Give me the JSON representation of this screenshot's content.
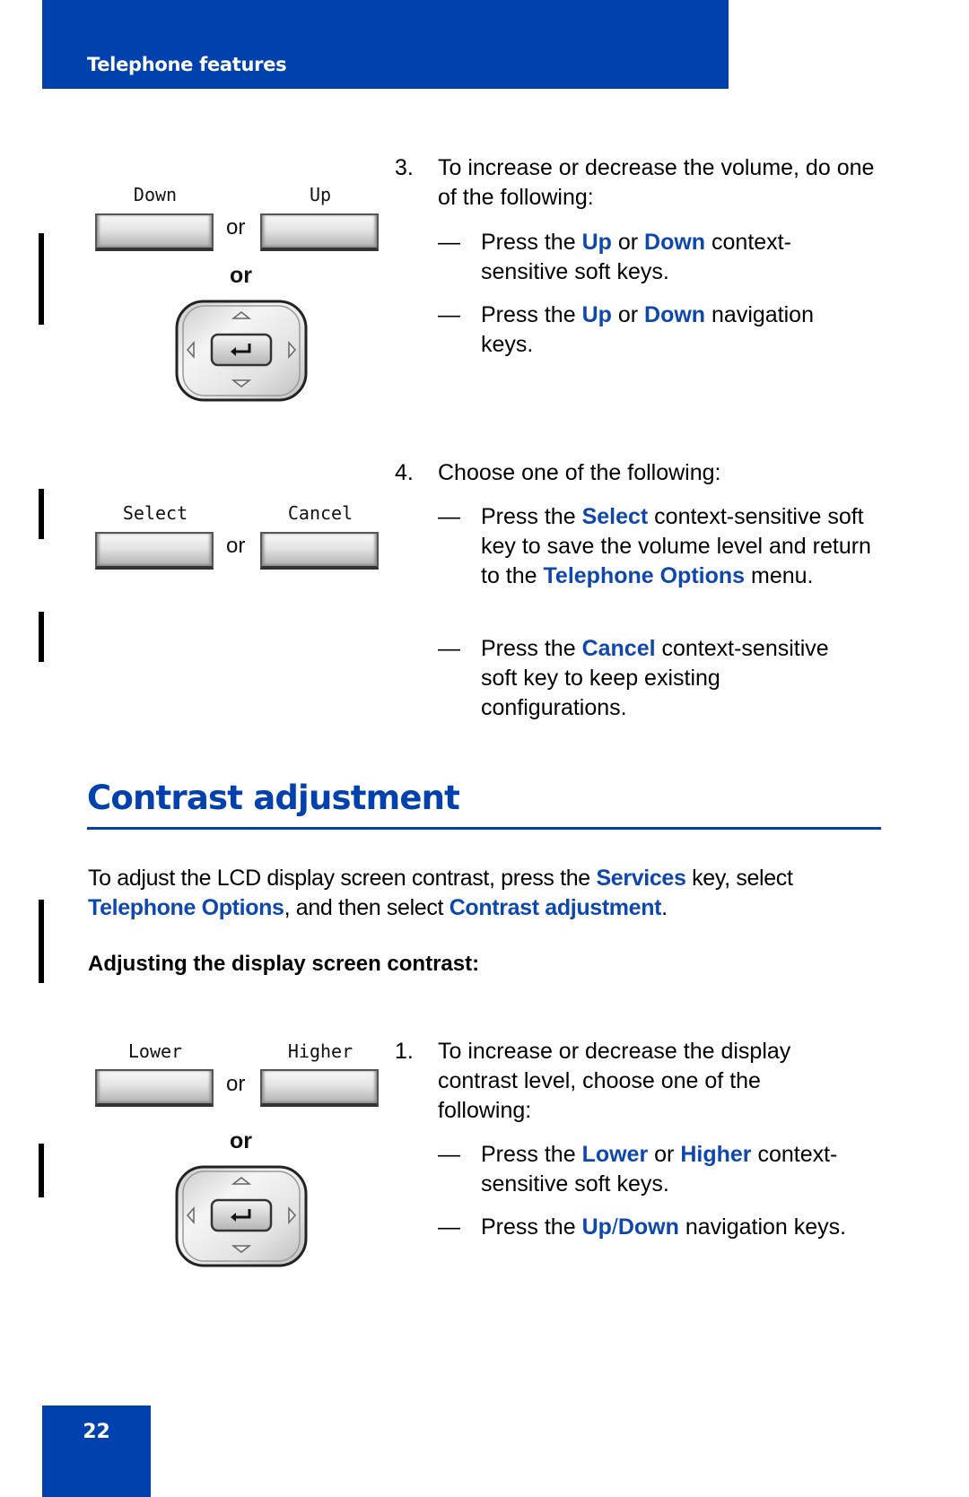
{
  "header": {
    "title": "Telephone features",
    "color": "#0041ad"
  },
  "volume_steps": {
    "softkeys_1": {
      "left_label": "Down",
      "right_label": "Up",
      "or_small": "or",
      "or_bold": "or"
    },
    "step3": {
      "number": "3.",
      "text": "To increase or decrease the volume, do one of the following:",
      "options": [
        {
          "dash": "—",
          "parts": [
            "Press the ",
            "Up",
            " or ",
            "Down",
            " context-sensitive soft keys."
          ]
        },
        {
          "dash": "—",
          "parts": [
            "Press the ",
            "Up",
            " or ",
            "Down",
            " navigation keys."
          ]
        }
      ]
    },
    "softkeys_2": {
      "left_label": "Select",
      "right_label": "Cancel",
      "or_small": "or"
    },
    "step4": {
      "number": "4.",
      "text": "Choose one of the following:",
      "options": [
        {
          "dash": "—",
          "parts": [
            "Press the ",
            "Select",
            " context-sensitive soft key to save the volume level and return to the ",
            "Telephone Options",
            " menu."
          ]
        },
        {
          "dash": "—",
          "parts": [
            "Press the ",
            "Cancel",
            " context-sensitive soft key to keep existing configurations."
          ]
        }
      ]
    }
  },
  "contrast": {
    "title": "Contrast adjustment",
    "intro_parts": [
      "To adjust the LCD display screen contrast, press the ",
      "Services",
      " key, select ",
      "Telephone Options",
      ", and then select ",
      "Contrast adjustment",
      "."
    ],
    "procedure_title": "Adjusting the display screen contrast:",
    "softkeys": {
      "left_label": "Lower",
      "right_label": "Higher",
      "or_small": "or",
      "or_bold": "or"
    },
    "step1": {
      "number": "1.",
      "text": "To increase or decrease the display contrast level, choose one of the following:",
      "options": [
        {
          "dash": "—",
          "parts": [
            "Press the ",
            "Lower",
            " or ",
            "Higher",
            " context-sensitive soft keys."
          ]
        },
        {
          "dash": "—",
          "parts": [
            "Press the ",
            "Up",
            "/",
            "Down",
            " navigation keys."
          ]
        }
      ]
    }
  },
  "icons": {
    "navigation_cluster": "navigation-keypad-icon",
    "enter_key": "enter-return-icon",
    "arrows": [
      "up-arrow-icon",
      "down-arrow-icon",
      "left-arrow-icon",
      "right-arrow-icon"
    ]
  },
  "footer": {
    "page_number": "22"
  }
}
